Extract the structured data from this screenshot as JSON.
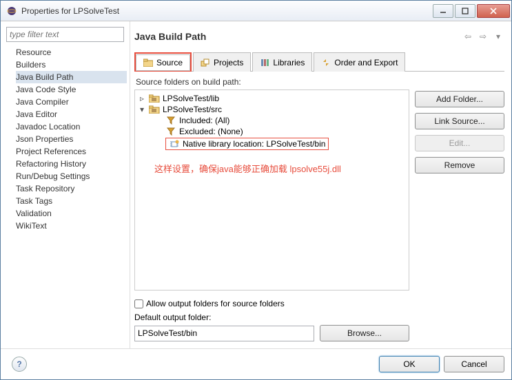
{
  "window": {
    "title": "Properties for LPSolveTest"
  },
  "filter": {
    "placeholder": "type filter text"
  },
  "sidebar": {
    "items": [
      "Resource",
      "Builders",
      "Java Build Path",
      "Java Code Style",
      "Java Compiler",
      "Java Editor",
      "Javadoc Location",
      "Json Properties",
      "Project References",
      "Refactoring History",
      "Run/Debug Settings",
      "Task Repository",
      "Task Tags",
      "Validation",
      "WikiText"
    ],
    "selected": 2
  },
  "page": {
    "title": "Java Build Path"
  },
  "tabs": {
    "items": [
      "Source",
      "Projects",
      "Libraries",
      "Order and Export"
    ],
    "active": 0
  },
  "tree": {
    "label": "Source folders on build path:",
    "nodes": [
      {
        "label": "LPSolveTest/lib",
        "expanded": false
      },
      {
        "label": "LPSolveTest/src",
        "expanded": true,
        "children": [
          {
            "label": "Included: (All)"
          },
          {
            "label": "Excluded: (None)"
          },
          {
            "label": "Native library location: LPSolveTest/bin",
            "highlight": true
          }
        ]
      }
    ]
  },
  "annotation": "这样设置，确保java能够正确加载 lpsolve55j.dll",
  "rightButtons": {
    "addFolder": "Add Folder...",
    "linkSource": "Link Source...",
    "edit": "Edit...",
    "remove": "Remove"
  },
  "bottom": {
    "allowOutput": "Allow output folders for source folders",
    "defaultLabel": "Default output folder:",
    "defaultValue": "LPSolveTest/bin",
    "browse": "Browse..."
  },
  "dialog": {
    "ok": "OK",
    "cancel": "Cancel"
  }
}
